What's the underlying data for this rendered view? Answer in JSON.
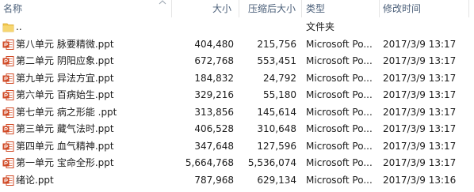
{
  "columns": {
    "name": "名称",
    "size": "大小",
    "compressed": "压缩后大小",
    "type": "类型",
    "modified": "修改时间"
  },
  "parent_row": {
    "name": "..",
    "type": "文件夹"
  },
  "files": [
    {
      "name": "第八单元 脉要精微.ppt",
      "size": "404,480",
      "compressed": "215,756",
      "type": "Microsoft Po...",
      "modified": "2017/3/9 13:17"
    },
    {
      "name": "第二单元 阴阳应象.ppt",
      "size": "672,768",
      "compressed": "553,451",
      "type": "Microsoft Po...",
      "modified": "2017/3/9 13:17"
    },
    {
      "name": "第九单元  异法方宜.ppt",
      "size": "184,832",
      "compressed": "24,792",
      "type": "Microsoft Po...",
      "modified": "2017/3/9 13:17"
    },
    {
      "name": "第六单元 百病始生.ppt",
      "size": "329,216",
      "compressed": "55,180",
      "type": "Microsoft Po...",
      "modified": "2017/3/9 13:17"
    },
    {
      "name": "第七单元 病之形能 .ppt",
      "size": "313,856",
      "compressed": "145,614",
      "type": "Microsoft Po...",
      "modified": "2017/3/9 13:17"
    },
    {
      "name": "第三单元 藏气法时.ppt",
      "size": "406,528",
      "compressed": "310,648",
      "type": "Microsoft Po...",
      "modified": "2017/3/9 13:17"
    },
    {
      "name": "第四单元 血气精神.ppt",
      "size": "347,648",
      "compressed": "127,596",
      "type": "Microsoft Po...",
      "modified": "2017/3/9 13:17"
    },
    {
      "name": "第一单元 宝命全形.ppt",
      "size": "5,664,768",
      "compressed": "5,536,074",
      "type": "Microsoft Po...",
      "modified": "2017/3/9 13:17"
    },
    {
      "name": "绪论.ppt",
      "size": "787,968",
      "compressed": "629,134",
      "type": "Microsoft Po...",
      "modified": "2017/3/9 13:16"
    }
  ],
  "colors": {
    "header_text": "#4c607a",
    "ppt_icon": "#d04a26",
    "folder_icon": "#f2c74e"
  },
  "icons": {
    "file": "powerpoint-file-icon",
    "parent": "folder-icon",
    "sort": "sort-up-arrow-icon"
  }
}
